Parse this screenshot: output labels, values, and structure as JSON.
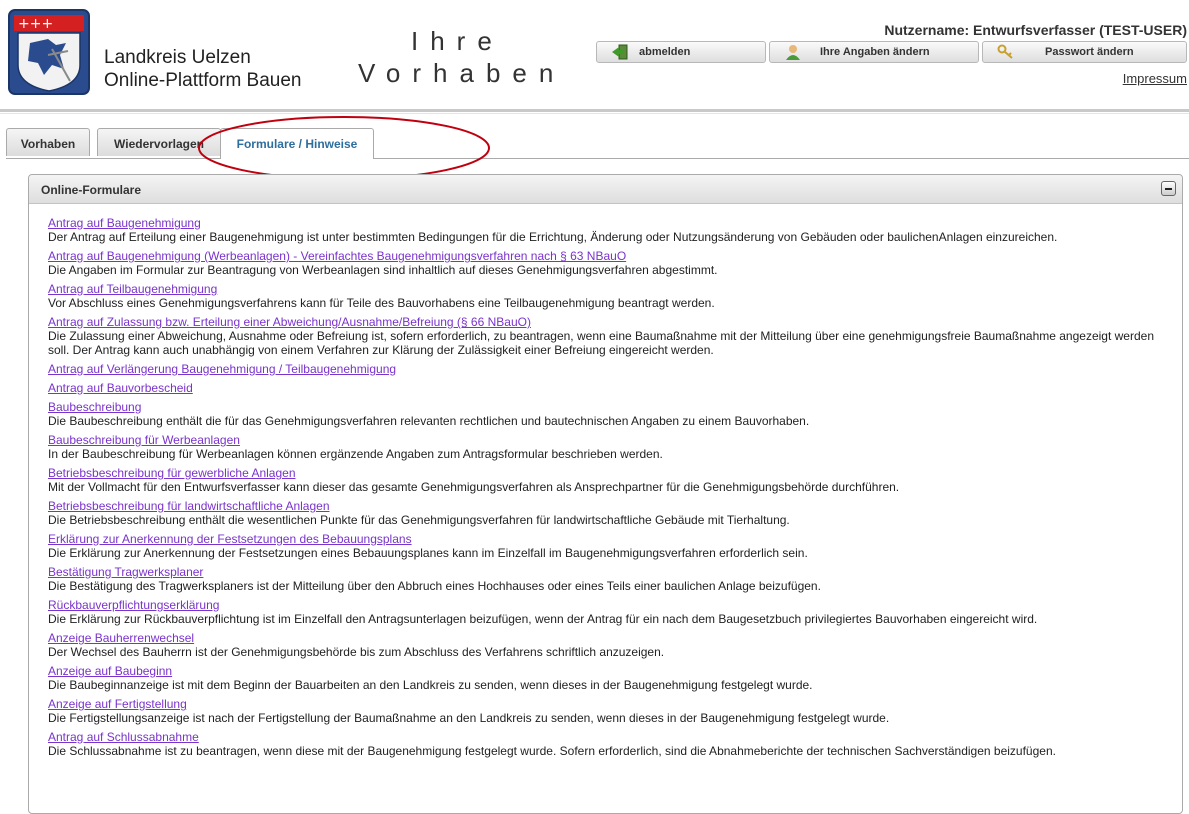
{
  "header": {
    "org_line1": "Landkreis Uelzen",
    "org_line2": "Online-Plattform Bauen",
    "title_line1": "Ihre",
    "title_line2": "Vorhaben",
    "username": "Nutzername: Entwurfsverfasser (TEST-USER)",
    "logout_label": "abmelden",
    "profile_label": "Ihre Angaben ändern",
    "password_label": "Passwort ändern",
    "impressum": "Impressum"
  },
  "tabs": [
    {
      "label": "Vorhaben"
    },
    {
      "label": "Wiedervorlagen"
    },
    {
      "label": "Formulare / Hinweise",
      "active": true
    }
  ],
  "panel": {
    "title": "Online-Formulare"
  },
  "colors": {
    "link": "#7a33cc",
    "highlight_ellipse": "#c0000e",
    "active_tab_text": "#2e6e9e"
  },
  "forms": [
    {
      "link": "Antrag auf Baugenehmigung",
      "desc": "Der Antrag auf Erteilung einer Baugenehmigung ist unter bestimmten Bedingungen für die Errichtung, Änderung oder Nutzungsänderung von Gebäuden oder baulichenAnlagen einzureichen."
    },
    {
      "link": "Antrag auf Baugenehmigung (Werbeanlagen) - Vereinfachtes Baugenehmigungsverfahren nach § 63 NBauO",
      "desc": "Die Angaben im Formular zur Beantragung von Werbeanlagen sind inhaltlich auf dieses Genehmigungsverfahren abgestimmt."
    },
    {
      "link": "Antrag auf Teilbaugenehmigung",
      "desc": "Vor Abschluss eines Genehmigungsverfahrens kann für Teile des Bauvorhabens eine Teilbaugenehmigung beantragt werden."
    },
    {
      "link": "Antrag auf Zulassung bzw. Erteilung einer Abweichung/Ausnahme/Befreiung (§ 66 NBauO)",
      "desc": "Die Zulassung einer Abweichung, Ausnahme oder Befreiung ist, sofern erforderlich, zu beantragen, wenn eine Baumaßnahme mit der Mitteilung über eine genehmigungsfreie Baumaßnahme angezeigt werden soll. Der Antrag kann auch unabhängig von einem Verfahren zur Klärung der Zulässigkeit einer Befreiung eingereicht werden."
    },
    {
      "link": "Antrag auf Verlängerung Baugenehmigung / Teilbaugenehmigung",
      "desc": ""
    },
    {
      "link": "Antrag auf Bauvorbescheid",
      "desc": ""
    },
    {
      "link": "Baubeschreibung",
      "desc": "Die Baubeschreibung enthält die für das Genehmigungsverfahren relevanten rechtlichen und bautechnischen Angaben zu einem Bauvorhaben."
    },
    {
      "link": "Baubeschreibung für Werbeanlagen",
      "desc": "In der Baubeschreibung für Werbeanlagen können ergänzende Angaben zum Antragsformular beschrieben werden."
    },
    {
      "link": "Betriebsbeschreibung für gewerbliche Anlagen",
      "desc": "Mit der Vollmacht für den Entwurfsverfasser kann dieser das gesamte Genehmigungsverfahren als Ansprechpartner für die Genehmigungsbehörde durchführen."
    },
    {
      "link": "Betriebsbeschreibung für landwirtschaftliche Anlagen",
      "desc": "Die Betriebsbeschreibung enthält die wesentlichen Punkte für das Genehmigungsverfahren für landwirtschaftliche Gebäude mit Tierhaltung."
    },
    {
      "link": "Erklärung zur Anerkennung der Festsetzungen des Bebauungsplans",
      "desc": "Die Erklärung zur Anerkennung der Festsetzungen eines Bebauungsplanes kann im Einzelfall im Baugenehmigungsverfahren erforderlich sein."
    },
    {
      "link": "Bestätigung Tragwerksplaner",
      "desc": "Die Bestätigung des Tragwerksplaners ist der Mitteilung über den Abbruch eines Hochhauses oder eines Teils einer baulichen Anlage beizufügen."
    },
    {
      "link": "Rückbauverpflichtungserklärung",
      "desc": "Die Erklärung zur Rückbauverpflichtung ist im Einzelfall den Antragsunterlagen beizufügen, wenn der Antrag für ein nach dem Baugesetzbuch privilegiertes Bauvorhaben eingereicht wird."
    },
    {
      "link": "Anzeige Bauherrenwechsel",
      "desc": "Der Wechsel des Bauherrn ist der Genehmigungsbehörde bis zum Abschluss des Verfahrens schriftlich anzuzeigen."
    },
    {
      "link": "Anzeige auf Baubeginn",
      "desc": "Die Baubeginnanzeige ist mit dem Beginn der Bauarbeiten an den Landkreis zu senden, wenn dieses in der Baugenehmigung festgelegt wurde."
    },
    {
      "link": "Anzeige auf Fertigstellung",
      "desc": "Die Fertigstellungsanzeige ist nach der Fertigstellung der Baumaßnahme an den Landkreis zu senden, wenn dieses in der Baugenehmigung festgelegt wurde."
    },
    {
      "link": "Antrag auf Schlussabnahme",
      "desc": "Die Schlussabnahme ist zu beantragen, wenn diese mit der Baugenehmigung festgelegt wurde. Sofern erforderlich, sind die Abnahmeberichte der technischen Sachverständigen beizufügen."
    }
  ]
}
